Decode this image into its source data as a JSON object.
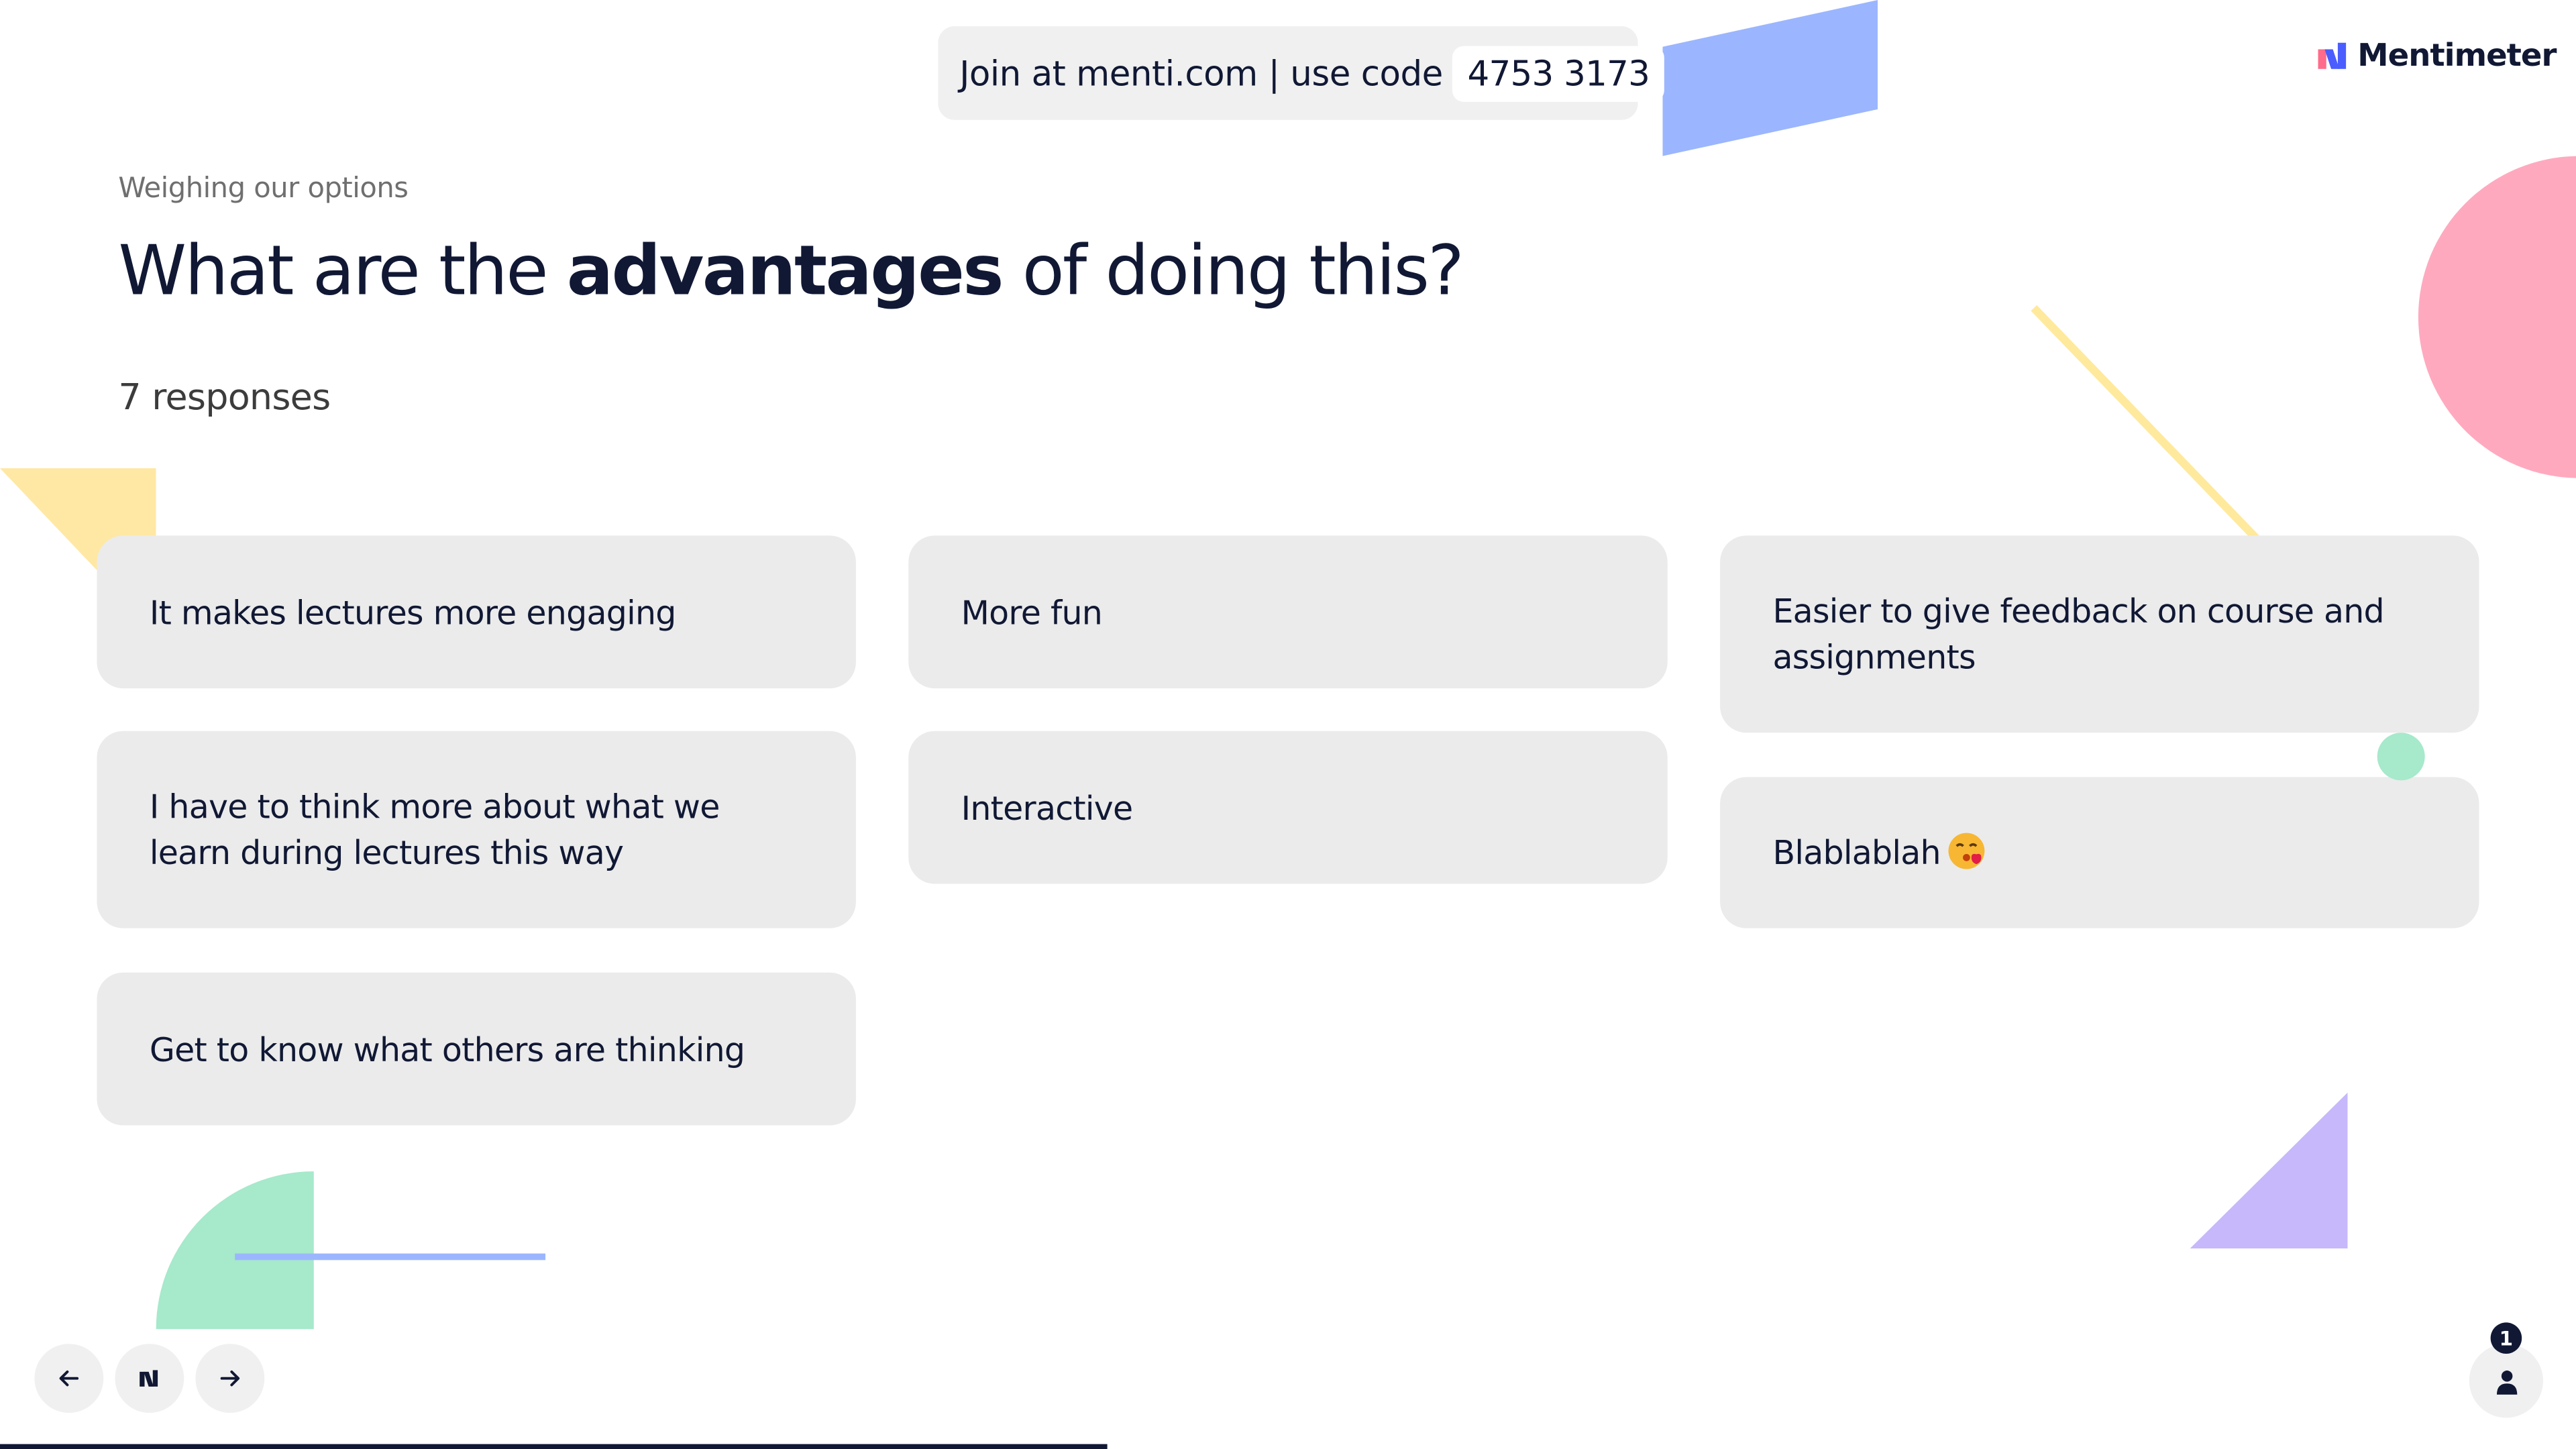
{
  "join_bar": {
    "text": "Join at menti.com | use code",
    "code": "4753 3173"
  },
  "brand": {
    "name": "Mentimeter"
  },
  "slide": {
    "subheading": "Weighing our options",
    "title_before": "What are the ",
    "title_bold": "advantages",
    "title_after": " of doing this?",
    "response_count": "7 responses"
  },
  "responses": [
    {
      "text": "It makes lectures more engaging"
    },
    {
      "text": "More fun"
    },
    {
      "text": "Easier to give feedback on course and assignments"
    },
    {
      "text": "I have to think more about what we learn during lectures this way"
    },
    {
      "text": "Interactive"
    },
    {
      "text": "Blablablah"
    },
    {
      "text": "Get to know what others are thinking"
    }
  ],
  "controls": {
    "prev_icon": "arrow-left-icon",
    "menu_icon": "mentimeter-logo-icon",
    "next_icon": "arrow-right-icon",
    "participants_icon": "person-icon",
    "participant_count": "1",
    "progress_fraction": 0.43
  },
  "colors": {
    "text": "#101834",
    "card": "#ebebeb",
    "accent_blue": "#9bb6ff",
    "accent_pink": "#ffa9bf",
    "accent_yellow": "#ffe8a4",
    "accent_green": "#a6e9cb",
    "accent_purple": "#c7b8fb"
  }
}
